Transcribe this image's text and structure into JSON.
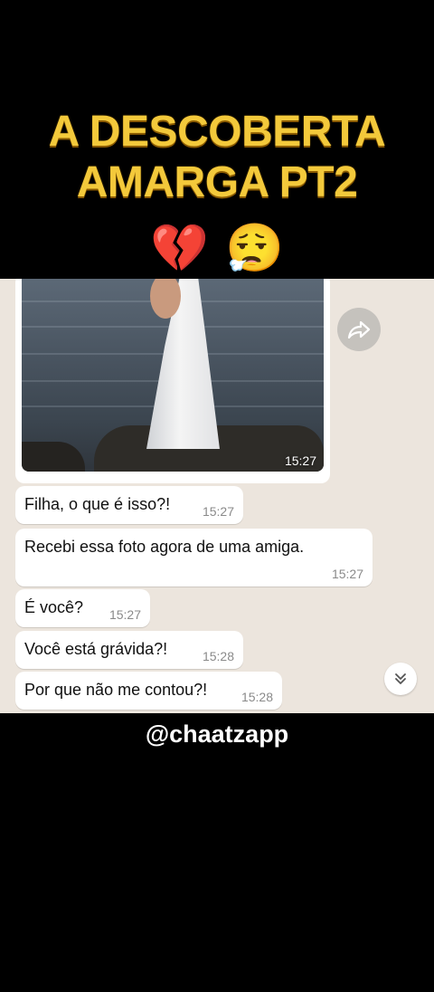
{
  "title": {
    "line1": "A DESCOBERTA",
    "line2": "AMARGA PT2"
  },
  "emojis": [
    "💔",
    "😮‍💨"
  ],
  "chat": {
    "photo_time": "15:27",
    "messages": [
      {
        "text": "Filha, o que é isso?!",
        "time": "15:27"
      },
      {
        "text": "Recebi essa foto agora de uma amiga.",
        "time": "15:27"
      },
      {
        "text": "É você?",
        "time": "15:27"
      },
      {
        "text": "Você está grávida?!",
        "time": "15:28"
      },
      {
        "text": "Por que não me contou?!",
        "time": "15:28"
      }
    ]
  },
  "icons": {
    "forward": "forward-icon",
    "scroll_down": "double-chevron-down-icon"
  },
  "colors": {
    "title": "#f3c93b",
    "chat_bg": "#ece5dd",
    "bubble": "#ffffff"
  },
  "handle": "@chaatzapp"
}
